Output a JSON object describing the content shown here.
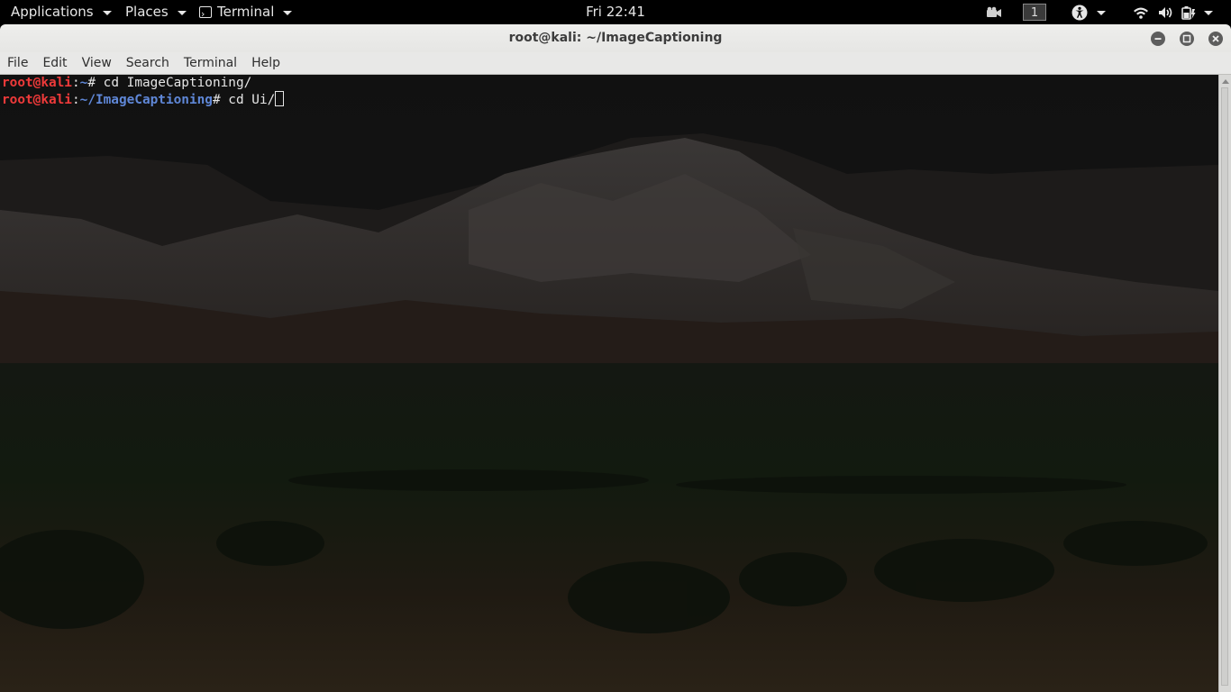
{
  "top_panel": {
    "applications_label": "Applications",
    "places_label": "Places",
    "terminal_label": "Terminal",
    "clock": "Fri 22:41",
    "workspace_number": "1"
  },
  "window": {
    "title": "root@kali: ~/ImageCaptioning",
    "menu": [
      "File",
      "Edit",
      "View",
      "Search",
      "Terminal",
      "Help"
    ]
  },
  "terminal": {
    "lines": [
      {
        "user": "root@kali",
        "sep": ":",
        "path": "~",
        "prompt": "#",
        "command": " cd ImageCaptioning/"
      },
      {
        "user": "root@kali",
        "sep": ":",
        "path": "~/ImageCaptioning",
        "prompt": "#",
        "command": " cd Ui/"
      }
    ]
  },
  "colors": {
    "prompt_user": "#ef3a3a",
    "prompt_path": "#5f87d7",
    "terminal_text": "#e5e5e5"
  }
}
